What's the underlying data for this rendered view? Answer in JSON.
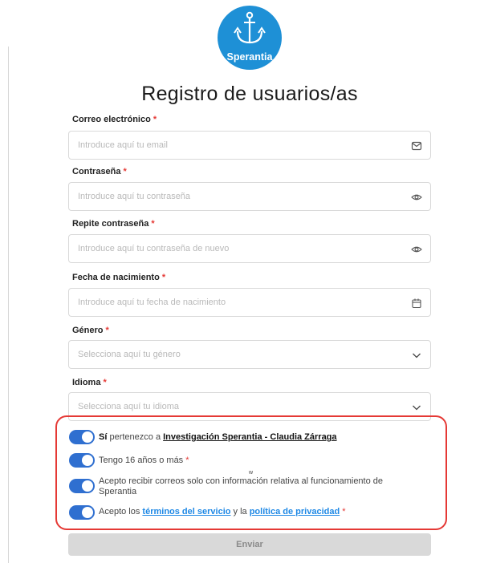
{
  "brand": {
    "logo_text": "Sperantia"
  },
  "page_title": "Registro de usuarios/as",
  "required_mark": "*",
  "fields": {
    "email": {
      "label": "Correo electrónico",
      "placeholder": "Introduce aquí tu email",
      "icon": "mail-icon"
    },
    "password": {
      "label": "Contraseña",
      "placeholder": "Introduce aquí tu contraseña",
      "icon": "eye-icon"
    },
    "password_repeat": {
      "label": "Repite contraseña",
      "placeholder": "Introduce aquí tu contraseña de nuevo",
      "icon": "eye-icon"
    },
    "birthdate": {
      "label": "Fecha de nacimiento",
      "placeholder": "Introduce aquí tu fecha de nacimiento",
      "icon": "calendar-icon"
    },
    "gender": {
      "label": "Género",
      "placeholder": "Selecciona aquí tu género",
      "icon": "chevron-down-icon"
    },
    "language": {
      "label": "Idioma",
      "placeholder": "Selecciona aquí tu idioma",
      "icon": "chevron-down-icon"
    }
  },
  "consents": {
    "research": {
      "strong": "Sí",
      "text": " pertenezco a ",
      "link": "Investigación Sperantia - Claudia Zárraga",
      "on": true
    },
    "age": {
      "text": "Tengo 16 años o más",
      "on": true
    },
    "emails": {
      "line1": "Acepto recibir correos solo con información relativa al funcionamiento de",
      "line2": "Sperantia",
      "stray_char": "w",
      "on": true
    },
    "terms": {
      "pre": "Acepto los ",
      "terms_link": "términos del servicio",
      "mid": " y la ",
      "privacy_link": "política de privacidad",
      "on": true
    }
  },
  "submit_label": "Enviar",
  "colors": {
    "brand_blue": "#1e90d6",
    "toggle_on": "#2f6fd0",
    "link_blue": "#1e88e5",
    "highlight_red": "#e53935",
    "button_disabled": "#d9d9d9"
  }
}
